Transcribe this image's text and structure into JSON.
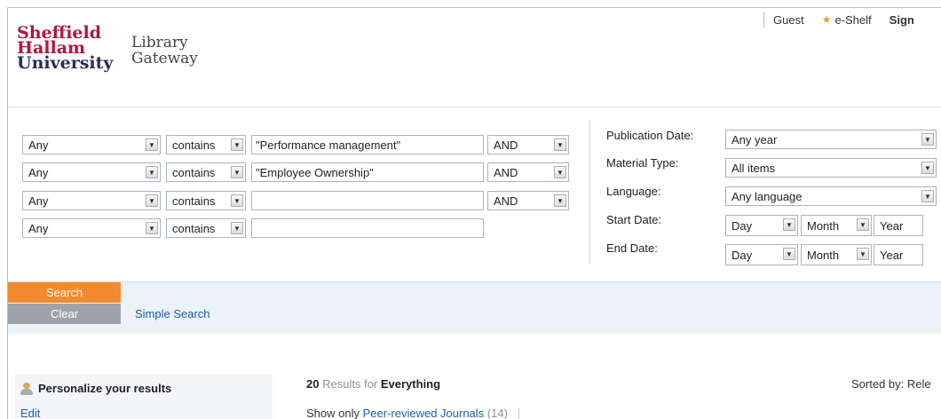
{
  "header": {
    "logo_line1": "Sheffield",
    "logo_line2": "Hallam",
    "logo_line3": "University",
    "gateway_line1": "Library",
    "gateway_line2": "Gateway",
    "user_label": "Guest",
    "eshelf_label": "e-Shelf",
    "sign_label": "Sign",
    "eshelf_icon": "star-icon"
  },
  "search": {
    "rows": [
      {
        "field": "Any",
        "operator": "contains",
        "query": "\"Performance management\"",
        "bool": "AND"
      },
      {
        "field": "Any",
        "operator": "contains",
        "query": "\"Employee Ownership\"",
        "bool": "AND"
      },
      {
        "field": "Any",
        "operator": "contains",
        "query": "",
        "bool": "AND"
      },
      {
        "field": "Any",
        "operator": "contains",
        "query": ""
      }
    ],
    "filters": {
      "publication_date_label": "Publication Date:",
      "publication_date_value": "Any year",
      "material_type_label": "Material Type:",
      "material_type_value": "All items",
      "language_label": "Language:",
      "language_value": "Any language",
      "start_date_label": "Start Date:",
      "end_date_label": "End Date:",
      "day": "Day",
      "month": "Month",
      "year": "Year"
    },
    "search_button": "Search",
    "clear_button": "Clear",
    "simple_search_link": "Simple Search"
  },
  "results": {
    "personalize_label": "Personalize your results",
    "edit_link": "Edit",
    "count": "20",
    "results_text": "Results",
    "for_text": "for",
    "scope": "Everything",
    "sorted_by": "Sorted by:",
    "sort_value": "Rele",
    "show_only": "Show only",
    "peer_reviewed": "Peer-reviewed Journals",
    "peer_count": "(14)"
  },
  "colors": {
    "brand_red": "#b0163e",
    "brand_navy": "#2a2b5c",
    "search_button": "#f28a30",
    "clear_button": "#9ea3a8",
    "link": "#1a5fa8"
  }
}
